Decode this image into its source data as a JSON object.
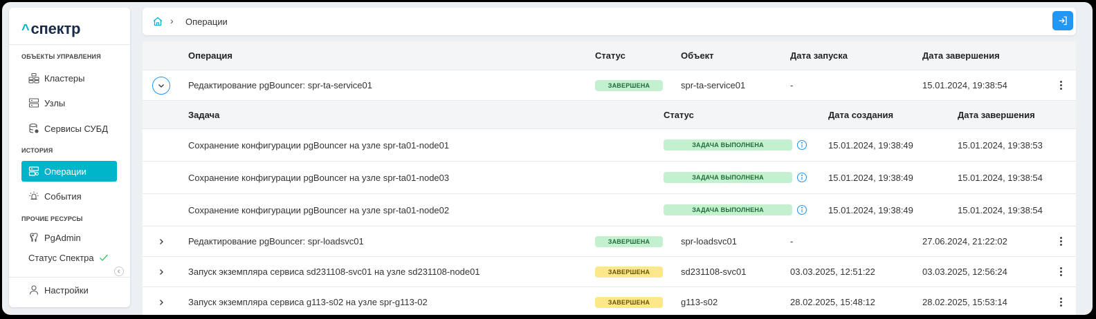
{
  "sidebar": {
    "logo_caret": "^",
    "logo_text": "спектр",
    "sections": {
      "objects": "ОБЪЕКТЫ УПРАВЛЕНИЯ",
      "history": "ИСТОРИЯ",
      "other": "ПРОЧИЕ РЕСУРСЫ"
    },
    "items": {
      "clusters": "Кластеры",
      "nodes": "Узлы",
      "dbms": "Сервисы СУБД",
      "operations": "Операции",
      "events": "События",
      "pgadmin": "PgAdmin",
      "status": "Статус Спектра",
      "settings": "Настройки"
    }
  },
  "header": {
    "breadcrumb": "Операции",
    "breadcrumb_sep": "›"
  },
  "table": {
    "columns": {
      "operation": "Операция",
      "status": "Статус",
      "object": "Объект",
      "start": "Дата запуска",
      "end": "Дата завершения"
    },
    "rows": [
      {
        "name": "Редактирование pgBouncer: spr-ta-service01",
        "status": "ЗАВЕРШЕНА",
        "status_color": "green",
        "object": "spr-ta-service01",
        "start": "-",
        "end": "15.01.2024, 19:38:54",
        "expanded": true
      },
      {
        "name": "Редактирование pgBouncer: spr-loadsvc01",
        "status": "ЗАВЕРШЕНА",
        "status_color": "green",
        "object": "spr-loadsvc01",
        "start": "-",
        "end": "27.06.2024, 21:22:02"
      },
      {
        "name": "Запуск экземпляра сервиса sd231108-svc01 на узле sd231108-node01",
        "status": "ЗАВЕРШЕНА",
        "status_color": "yellow",
        "object": "sd231108-svc01",
        "start": "03.03.2025, 12:51:22",
        "end": "03.03.2025, 12:56:24"
      },
      {
        "name": "Запуск экземпляра сервиса g113-s02 на узле spr-g113-02",
        "status": "ЗАВЕРШЕНА",
        "status_color": "yellow",
        "object": "g113-s02",
        "start": "28.02.2025, 15:48:12",
        "end": "28.02.2025, 15:53:14"
      }
    ]
  },
  "subtable": {
    "columns": {
      "task": "Задача",
      "status": "Статус",
      "created": "Дата создания",
      "end": "Дата завершения"
    },
    "rows": [
      {
        "task": "Сохранение конфигурации pgBouncer на узле spr-ta01-node01",
        "status": "ЗАДАЧА ВЫПОЛНЕНА",
        "created": "15.01.2024, 19:38:49",
        "end": "15.01.2024, 19:38:53"
      },
      {
        "task": "Сохранение конфигурации pgBouncer на узле spr-ta01-node03",
        "status": "ЗАДАЧА ВЫПОЛНЕНА",
        "created": "15.01.2024, 19:38:49",
        "end": "15.01.2024, 19:38:54"
      },
      {
        "task": "Сохранение конфигурации pgBouncer на узле spr-ta01-node02",
        "status": "ЗАДАЧА ВЫПОЛНЕНА",
        "created": "15.01.2024, 19:38:49",
        "end": "15.01.2024, 19:38:54"
      }
    ]
  },
  "colors": {
    "accent": "#00b5c9",
    "primary_button": "#2196f3",
    "badge_green": "#c3f0cf",
    "badge_yellow": "#fbe88a"
  },
  "icons": {
    "home": "home-icon",
    "logout": "logout-icon",
    "info": "info-icon",
    "clusters": "clusters-icon",
    "nodes": "server-icon",
    "dbms": "database-icon",
    "operations": "operations-icon",
    "events": "events-icon",
    "pgadmin": "pgadmin-icon",
    "status_ok": "check-icon",
    "settings": "user-icon"
  }
}
